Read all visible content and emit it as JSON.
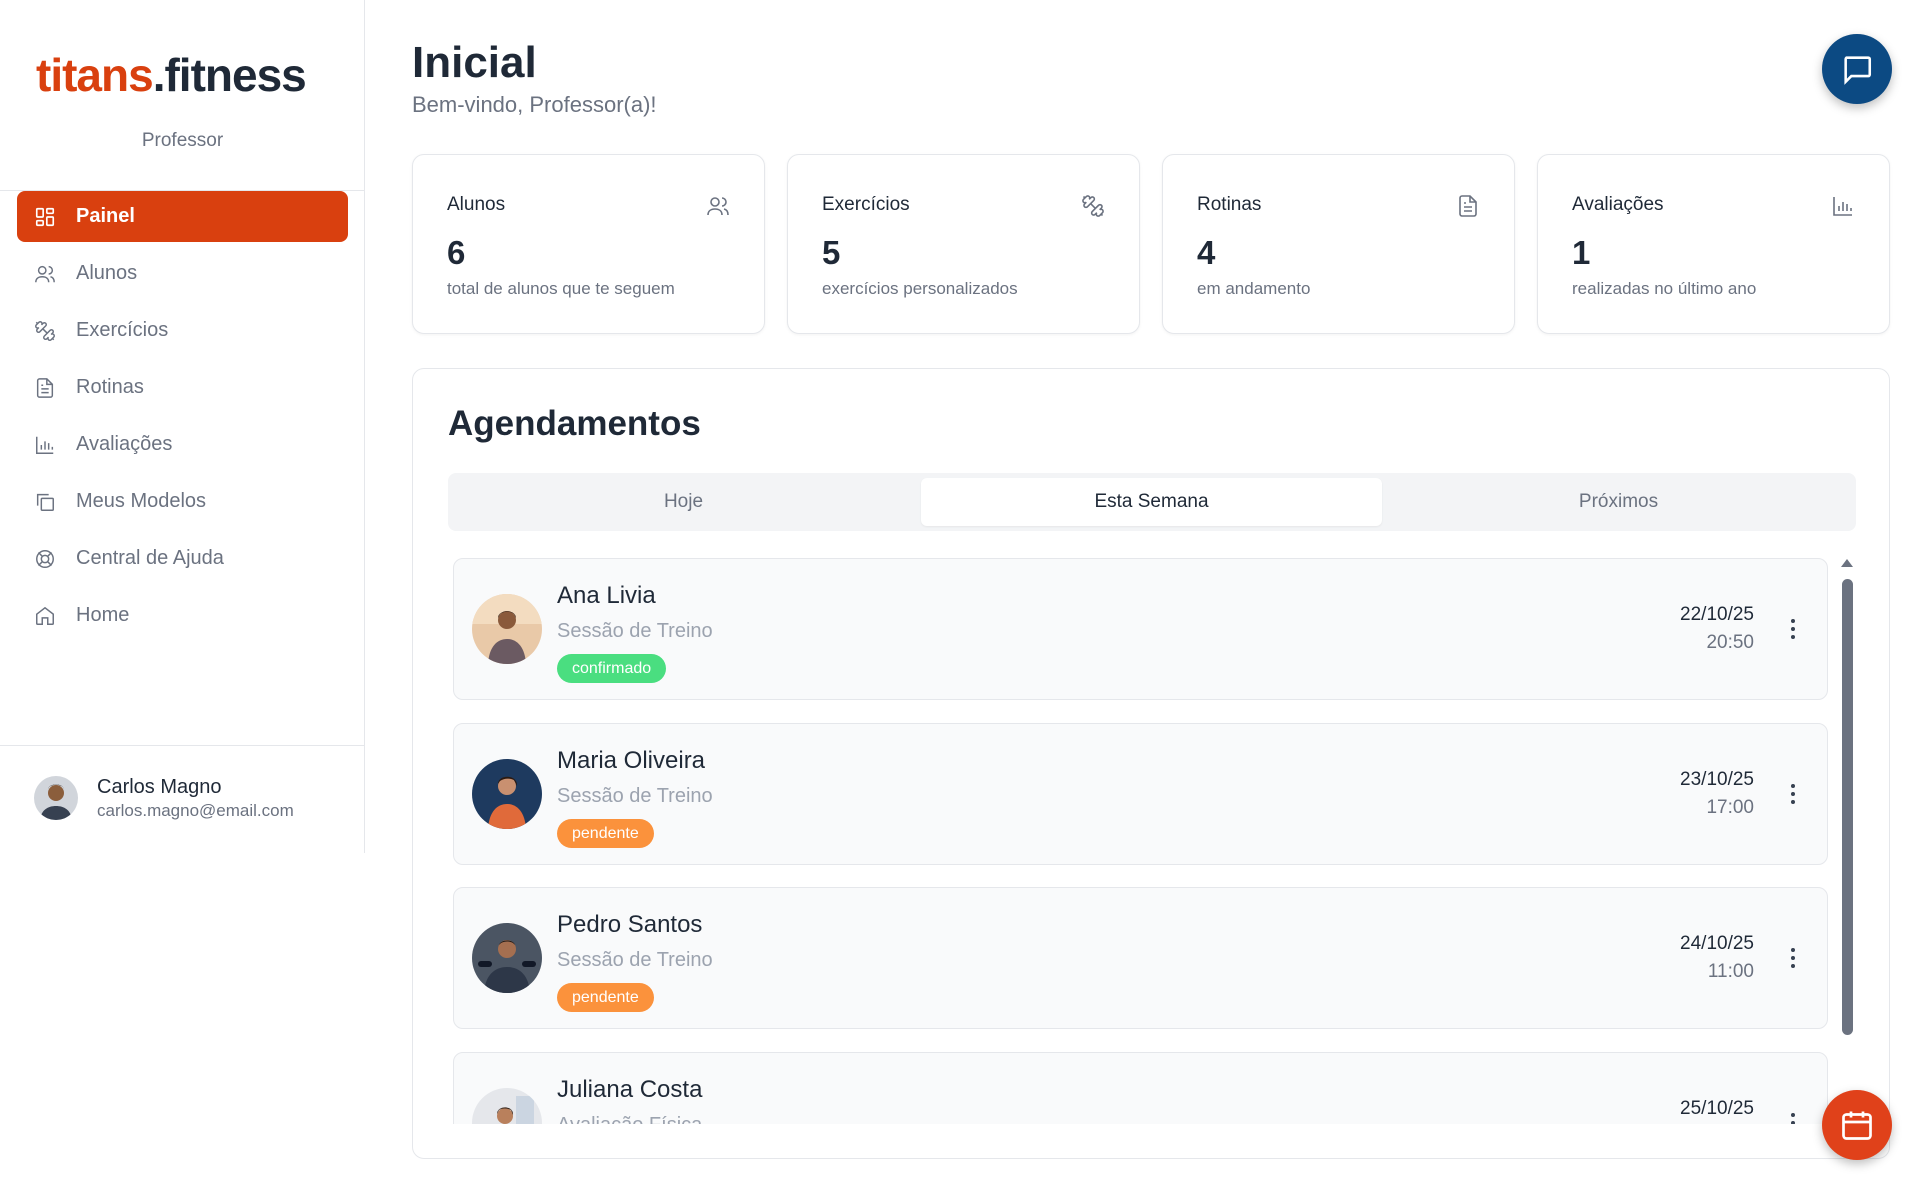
{
  "sidebar": {
    "logo_brand": "titans",
    "logo_suffix": ".fitness",
    "role": "Professor",
    "items": [
      {
        "label": "Painel",
        "icon": "grid-icon",
        "active": true
      },
      {
        "label": "Alunos",
        "icon": "users-icon"
      },
      {
        "label": "Exercícios",
        "icon": "dumbbell-icon"
      },
      {
        "label": "Rotinas",
        "icon": "document-icon"
      },
      {
        "label": "Avaliações",
        "icon": "bar-chart-icon"
      },
      {
        "label": "Meus Modelos",
        "icon": "copy-icon"
      },
      {
        "label": "Central de Ajuda",
        "icon": "lifebuoy-icon"
      },
      {
        "label": "Home",
        "icon": "home-icon"
      }
    ],
    "user": {
      "name": "Carlos Magno",
      "email": "carlos.magno@email.com"
    }
  },
  "header": {
    "title": "Inicial",
    "subtitle": "Bem-vindo, Professor(a)!"
  },
  "stats": [
    {
      "title": "Alunos",
      "value": "6",
      "desc": "total de alunos que te seguem",
      "icon": "users-icon"
    },
    {
      "title": "Exercícios",
      "value": "5",
      "desc": "exercícios personalizados",
      "icon": "dumbbell-icon"
    },
    {
      "title": "Rotinas",
      "value": "4",
      "desc": "em andamento",
      "icon": "document-icon"
    },
    {
      "title": "Avaliações",
      "value": "1",
      "desc": "realizadas no último ano",
      "icon": "bar-chart-icon"
    }
  ],
  "schedule": {
    "title": "Agendamentos",
    "tabs": [
      "Hoje",
      "Esta Semana",
      "Próximos"
    ],
    "active_tab": "Esta Semana",
    "appointments": [
      {
        "name": "Ana Livia",
        "type": "Sessão de Treino",
        "status": "confirmado",
        "status_color": "#4ade80",
        "date": "22/10/25",
        "time": "20:50"
      },
      {
        "name": "Maria Oliveira",
        "type": "Sessão de Treino",
        "status": "pendente",
        "status_color": "#fb923c",
        "date": "23/10/25",
        "time": "17:00"
      },
      {
        "name": "Pedro Santos",
        "type": "Sessão de Treino",
        "status": "pendente",
        "status_color": "#fb923c",
        "date": "24/10/25",
        "time": "11:00"
      },
      {
        "name": "Juliana Costa",
        "type": "Avaliação Física",
        "status": "",
        "status_color": "",
        "date": "25/10/25",
        "time": ""
      }
    ]
  },
  "colors": {
    "brand": "#d9400f",
    "chat_fab": "#0c4a83",
    "calendar_fab": "#e0411a"
  },
  "fabs": {
    "chat": "chat-icon",
    "calendar": "calendar-icon"
  }
}
